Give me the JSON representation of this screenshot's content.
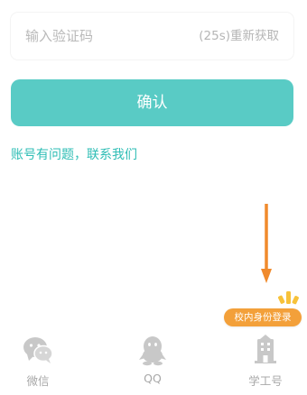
{
  "verification": {
    "placeholder": "输入验证码",
    "resend_label": "(25s)重新获取"
  },
  "confirm": {
    "label": "确认"
  },
  "help_link": {
    "label": "账号有问题，联系我们"
  },
  "tooltip": {
    "label": "校内身份登录"
  },
  "login_options": [
    {
      "label": "微信",
      "icon": "wechat-icon"
    },
    {
      "label": "QQ",
      "icon": "qq-icon"
    },
    {
      "label": "学工号",
      "icon": "building-icon"
    }
  ],
  "colors": {
    "accent": "#59cbc5",
    "link": "#2ebdb5",
    "highlight": "#f3a03a",
    "icon_gray": "#c8c8c8"
  }
}
